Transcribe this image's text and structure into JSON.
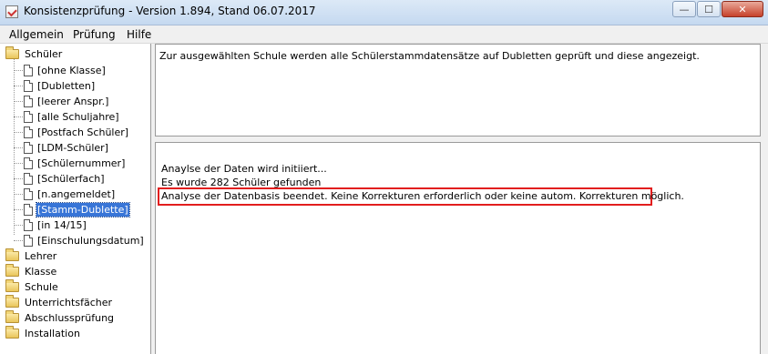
{
  "window": {
    "title": "Konsistenzprüfung - Version 1.894, Stand 06.07.2017",
    "icon": "app-check-icon",
    "controls": {
      "minimize": "—",
      "maximize": "☐",
      "close": "✕"
    }
  },
  "menu": [
    {
      "label": "Allgemein"
    },
    {
      "label": "Prüfung"
    },
    {
      "label": "Hilfe"
    }
  ],
  "tree": {
    "root": {
      "label": "Schüler",
      "icon": "folder-icon"
    },
    "children": [
      {
        "label": "[ohne Klasse]",
        "icon": "document-icon",
        "selected": false
      },
      {
        "label": "[Dubletten]",
        "icon": "document-icon",
        "selected": false
      },
      {
        "label": "[leerer Anspr.]",
        "icon": "document-icon",
        "selected": false
      },
      {
        "label": "[alle Schuljahre]",
        "icon": "document-icon",
        "selected": false
      },
      {
        "label": "[Postfach Schüler]",
        "icon": "document-icon",
        "selected": false
      },
      {
        "label": "[LDM-Schüler]",
        "icon": "document-icon",
        "selected": false
      },
      {
        "label": "[Schülernummer]",
        "icon": "document-icon",
        "selected": false
      },
      {
        "label": "[Schülerfach]",
        "icon": "document-icon",
        "selected": false
      },
      {
        "label": "[n.angemeldet]",
        "icon": "document-icon",
        "selected": false
      },
      {
        "label": "[Stamm-Dublette]",
        "icon": "document-icon",
        "selected": true
      },
      {
        "label": "[in 14/15]",
        "icon": "document-icon",
        "selected": false
      },
      {
        "label": "[Einschulungsdatum]",
        "icon": "document-icon",
        "selected": false
      }
    ],
    "siblings": [
      {
        "label": "Lehrer",
        "icon": "folder-icon"
      },
      {
        "label": "Klasse",
        "icon": "folder-icon"
      },
      {
        "label": "Schule",
        "icon": "folder-icon"
      },
      {
        "label": "Unterrichtsfächer",
        "icon": "folder-icon"
      },
      {
        "label": "Abschlussprüfung",
        "icon": "folder-icon"
      },
      {
        "label": "Installation",
        "icon": "folder-icon"
      }
    ]
  },
  "description": {
    "text": "Zur ausgewählten Schule werden alle Schülerstammdatensätze auf Dubletten geprüft und diese angezeigt."
  },
  "log": {
    "lines": [
      "Anaylse der Daten wird initiiert...",
      "Es wurde 282 Schüler gefunden",
      "Analyse der Datenbasis beendet. Keine Korrekturen erforderlich oder keine autom. Korrekturen möglich."
    ],
    "highlight_color": "#e21e1e"
  },
  "colors": {
    "selection": "#3875d7",
    "titlebar": "#c5d9f0"
  }
}
